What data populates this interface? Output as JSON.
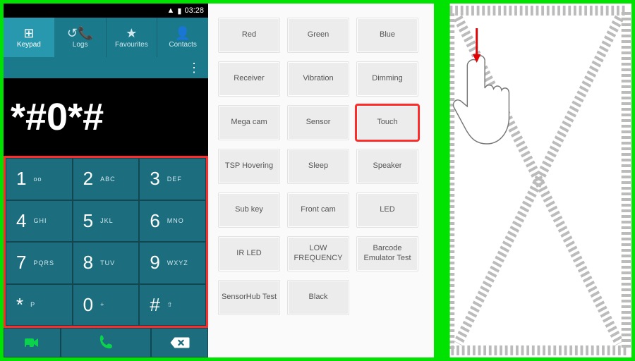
{
  "status": {
    "time": "03:28",
    "battery_icon": "▮",
    "signal_icon": "▲"
  },
  "tabs": [
    {
      "label": "Keypad",
      "icon": "⊞",
      "active": true
    },
    {
      "label": "Logs",
      "icon": "↺📞",
      "active": false
    },
    {
      "label": "Favourites",
      "icon": "★",
      "active": false
    },
    {
      "label": "Contacts",
      "icon": "👤",
      "active": false
    }
  ],
  "kebab": "⋮",
  "dialed": "*#0*#",
  "keys": [
    {
      "d": "1",
      "s": "ᴏᴏ"
    },
    {
      "d": "2",
      "s": "ABC"
    },
    {
      "d": "3",
      "s": "DEF"
    },
    {
      "d": "4",
      "s": "GHI"
    },
    {
      "d": "5",
      "s": "JKL"
    },
    {
      "d": "6",
      "s": "MNO"
    },
    {
      "d": "7",
      "s": "PQRS"
    },
    {
      "d": "8",
      "s": "TUV"
    },
    {
      "d": "9",
      "s": "WXYZ"
    },
    {
      "d": "*",
      "s": "P"
    },
    {
      "d": "0",
      "s": "+"
    },
    {
      "d": "#",
      "s": "⇧"
    }
  ],
  "bottom": {
    "video": "▣",
    "call": "📞",
    "del": "⌫"
  },
  "tests": [
    [
      "Red",
      "Green",
      "Blue"
    ],
    [
      "Receiver",
      "Vibration",
      "Dimming"
    ],
    [
      "Mega cam",
      "Sensor",
      "Touch"
    ],
    [
      "TSP Hovering",
      "Sleep",
      "Speaker"
    ],
    [
      "Sub key",
      "Front cam",
      "LED"
    ],
    [
      "IR LED",
      "LOW FREQUENCY",
      "Barcode Emulator Test"
    ],
    [
      "SensorHub Test",
      "Black"
    ]
  ],
  "tests_highlight": {
    "row": 2,
    "col": 2
  },
  "touch_arrow": "↓"
}
